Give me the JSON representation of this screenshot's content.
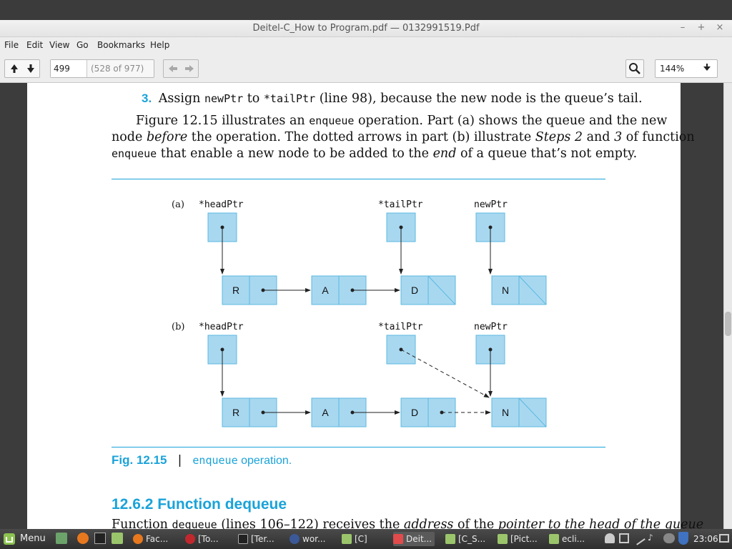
{
  "window": {
    "title": "Deitel-C_How to Program.pdf — 0132991519.Pdf"
  },
  "window_controls": {
    "minimize": "–",
    "maximize": "+",
    "close": "×"
  },
  "menu": [
    "File",
    "Edit",
    "View",
    "Go",
    "Bookmarks",
    "Help"
  ],
  "toolbar": {
    "page_value": "499",
    "page_info": "(528 of 977)",
    "zoom": "144%"
  },
  "doc": {
    "item_number": "3.",
    "item_text_a": "Assign ",
    "item_code_a": "newPtr",
    "item_text_b": " to ",
    "item_code_b": "*tailPtr",
    "item_text_c": " (line 98), because the new node is the queue’s tail.",
    "p1_a": "Figure 12.15 illustrates an ",
    "p1_code": "enqueue",
    "p1_b": " operation. Part (a) shows the queue and the new",
    "p2_a": "node ",
    "p2_em": "before",
    "p2_b": " the operation. The dotted arrows in part (b) illustrate ",
    "p2_em2": "Steps 2",
    "p2_c": " and ",
    "p2_em3": "3",
    "p2_d": " of function",
    "p3_code": "enqueue",
    "p3_a": " that enable a new node to be added to the ",
    "p3_em": "end",
    "p3_b": " of a queue that’s not empty.",
    "fig_num": "Fig. 12.15",
    "fig_sep": "|",
    "fig_code": "enqueue",
    "fig_caption": " operation.",
    "section_heading": "12.6.2 Function dequeue",
    "last_a": "Function ",
    "last_code": "dequeue",
    "last_b": " (lines 106–122) receives the ",
    "last_em": "address",
    "last_c": " of the ",
    "last_em2": "pointer to the head of the queue"
  },
  "figure": {
    "part_a": "(a)",
    "part_b": "(b)",
    "head_ptr": "*headPtr",
    "tail_ptr": "*tailPtr",
    "new_ptr": "newPtr",
    "nodes": [
      "R",
      "A",
      "D",
      "N"
    ]
  },
  "taskbar": {
    "menu_label": "Menu",
    "tasks": [
      "Fac...",
      "[To...",
      "[Ter...",
      "wor...",
      "[C]",
      "Deit...",
      "[C_S...",
      "[Pict...",
      "ecli..."
    ],
    "clock": "23:06"
  },
  "colors": {
    "accent": "#1aa3d9",
    "node_fill": "#a8d8f0",
    "node_stroke": "#5bb8e0",
    "window_bg": "#ededed"
  }
}
